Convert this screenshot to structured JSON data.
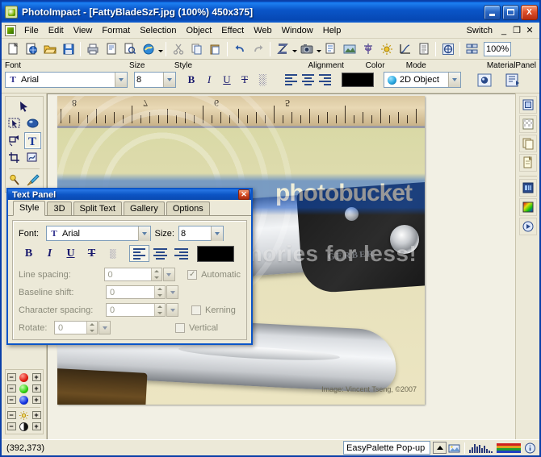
{
  "window": {
    "app_name": "PhotoImpact",
    "title": "PhotoImpact - [FattyBladeSzF.jpg (100%) 450x375]",
    "minimize_label": "Minimize",
    "maximize_label": "Maximize",
    "close_label": "X",
    "app_icon": "photoimpact-icon"
  },
  "menubar": {
    "doc_icon": "document-icon",
    "items": [
      {
        "label": "File"
      },
      {
        "label": "Edit"
      },
      {
        "label": "View"
      },
      {
        "label": "Format"
      },
      {
        "label": "Selection"
      },
      {
        "label": "Object"
      },
      {
        "label": "Effect"
      },
      {
        "label": "Web"
      },
      {
        "label": "Window"
      },
      {
        "label": "Help"
      }
    ],
    "switch_label": "Switch",
    "mdi_minimize": "_",
    "mdi_restore": "❐",
    "mdi_close": "✕"
  },
  "toolbar": {
    "groups": [
      [
        "new-file-icon",
        "new-web-icon",
        "open-folder-icon",
        "save-icon"
      ],
      [
        "print-icon",
        "print-preview-icon",
        "page-setup-icon",
        "browser-preview-icon"
      ],
      [
        "cut-icon",
        "copy-icon",
        "paste-icon"
      ],
      [
        "undo-icon",
        "redo-icon"
      ],
      [
        "transform-icon",
        "camera-icon",
        "crop-icon",
        "image-effect-icon",
        "beautify-icon",
        "brightness-icon",
        "curve-icon",
        "notes-icon"
      ],
      [
        "fill-icon",
        "align-objects-icon"
      ]
    ],
    "zoom_value": "100%"
  },
  "attribute_bar": {
    "labels": {
      "font": "Font",
      "size": "Size",
      "style": "Style",
      "alignment": "Alignment",
      "color": "Color",
      "mode": "Mode",
      "material": "Material",
      "panel": "Panel"
    },
    "font_value": "Arial",
    "size_value": "8",
    "style_buttons": [
      {
        "name": "bold-button",
        "glyph": "B"
      },
      {
        "name": "italic-button",
        "glyph": "I"
      },
      {
        "name": "underline-button",
        "glyph": "U"
      },
      {
        "name": "strikethrough-button",
        "glyph": "T"
      },
      {
        "name": "texture-text-button",
        "glyph": "░"
      }
    ],
    "alignment_buttons": [
      "align-left-button",
      "align-center-button",
      "align-right-button"
    ],
    "color_value": "#000000",
    "mode_value": "2D Object",
    "material_icon": "material-icon",
    "panel_icon": "panel-icon"
  },
  "toolbox": {
    "tools": [
      {
        "name": "pick-tool",
        "selected": false
      },
      {
        "name": "selection-tool",
        "selected": false
      },
      {
        "name": "path-edit-tool",
        "selected": false
      },
      {
        "name": "transform-tool",
        "selected": false
      },
      {
        "name": "text-tool",
        "selected": true
      },
      {
        "name": "crop-tool",
        "selected": false
      },
      {
        "name": "path-draw-tool",
        "selected": false
      },
      {
        "name": "magic-wand-tool",
        "selected": false
      },
      {
        "name": "paintbrush-tool",
        "selected": false
      }
    ]
  },
  "color_panel": {
    "rows": [
      {
        "name": "red-channel",
        "color": "#e01b10",
        "minus": "−",
        "plus": "+"
      },
      {
        "name": "green-channel",
        "color": "#2fd010",
        "minus": "−",
        "plus": "+"
      },
      {
        "name": "blue-channel",
        "color": "#1030e0",
        "minus": "−",
        "plus": "+"
      },
      {
        "name": "brightness-control",
        "color": "#f0d040",
        "minus": "−",
        "plus": "+"
      },
      {
        "name": "contrast-control",
        "color": "#000000",
        "minus": "−",
        "plus": "+"
      }
    ]
  },
  "right_rail": {
    "buttons": [
      "layer-manager-icon",
      "transparency-panel-icon",
      "duplicate-panel-icon",
      "new-object-icon",
      "easypalette-icon",
      "color-palette-icon",
      "quick-command-icon"
    ]
  },
  "canvas": {
    "image_caption": "Image: Vincent Tseng, ©2007",
    "brand_text": "GERBER",
    "watermark_text": "protect your memories for less!",
    "watermark_brand": "photobucket",
    "ruler_numbers": [
      "8",
      "7",
      "6",
      "5"
    ]
  },
  "text_panel": {
    "title": "Text Panel",
    "close_label": "✕",
    "tabs": [
      {
        "label": "Style",
        "active": true
      },
      {
        "label": "3D",
        "active": false
      },
      {
        "label": "Split Text",
        "active": false
      },
      {
        "label": "Gallery",
        "active": false
      },
      {
        "label": "Options",
        "active": false
      }
    ],
    "font_label": "Font:",
    "font_value": "Arial",
    "size_label": "Size:",
    "size_value": "8",
    "style_buttons": [
      {
        "name": "bold-button",
        "glyph": "B"
      },
      {
        "name": "italic-button",
        "glyph": "I"
      },
      {
        "name": "underline-button",
        "glyph": "U"
      },
      {
        "name": "strikethrough-button",
        "glyph": "T"
      },
      {
        "name": "texture-text-button",
        "glyph": "░"
      }
    ],
    "alignment_buttons": [
      "align-left-button",
      "align-center-button",
      "align-right-button"
    ],
    "color_value": "#000000",
    "fields": [
      {
        "label": "Line spacing:",
        "value": "0"
      },
      {
        "label": "Baseline shift:",
        "value": "0"
      },
      {
        "label": "Character spacing:",
        "value": "0"
      }
    ],
    "rotate_label": "Rotate:",
    "rotate_value": "0",
    "checkboxes": [
      {
        "label": "Automatic",
        "checked": true
      },
      {
        "label": "Kerning",
        "checked": false
      },
      {
        "label": "Vertical",
        "checked": false
      }
    ],
    "check_glyph": "✓"
  },
  "statusbar": {
    "coordinates": "(392,373)",
    "easypalette_label": "EasyPalette Pop-up",
    "icons": [
      "easypalette-toggle-icon",
      "histogram-icon",
      "color-bar-icon",
      "info-icon"
    ]
  }
}
